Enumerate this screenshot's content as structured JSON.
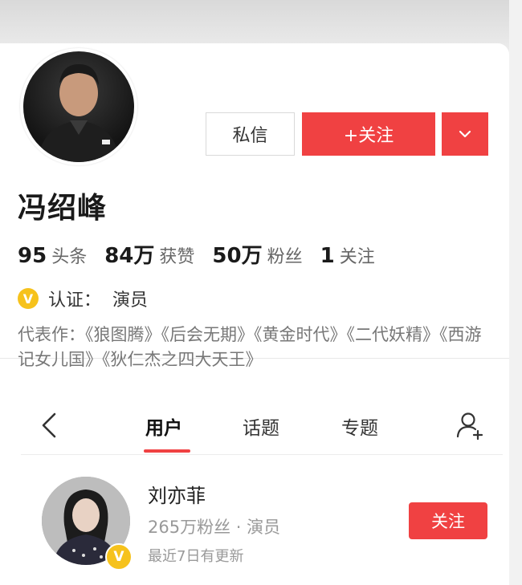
{
  "profile": {
    "name": "冯绍峰",
    "message_label": "私信",
    "follow_label": "+关注",
    "stats": [
      {
        "num": "95",
        "label": "头条"
      },
      {
        "num": "84万",
        "label": "获赞"
      },
      {
        "num": "50万",
        "label": "粉丝"
      },
      {
        "num": "1",
        "label": "关注"
      }
    ],
    "verify_badge": "V",
    "verify_text": "认证：  演员",
    "works": "代表作：《狼图腾》《后会无期》《黄金时代》《二代妖精》《西游记女儿国》《狄仁杰之四大天王》"
  },
  "tabs": {
    "items": [
      "用户",
      "话题",
      "专题"
    ],
    "active": "用户"
  },
  "user_result": {
    "name": "刘亦菲",
    "meta": "265万粉丝 · 演员",
    "update": "最近7日有更新",
    "badge": "V",
    "follow_label": "关注"
  },
  "colors": {
    "accent": "#f04142",
    "verified": "#f6c21c"
  },
  "icons": [
    "chevron-down-icon",
    "back-arrow-icon",
    "add-user-icon",
    "verified-badge-icon"
  ]
}
